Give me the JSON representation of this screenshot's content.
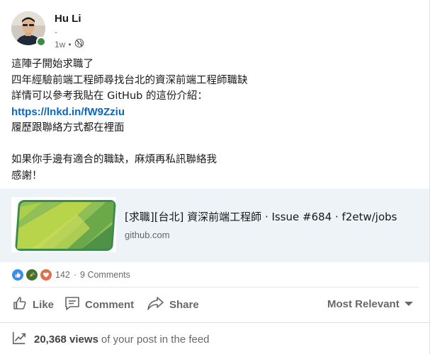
{
  "post": {
    "author": {
      "name": "Hu Li",
      "headline": "-",
      "time": "1w",
      "separator": "•",
      "visibility_icon": "globe-icon",
      "presence": "online"
    },
    "text_lines": [
      "這陣子開始求職了",
      "四年經驗前端工程師尋找台北的資深前端工程師職缺",
      "詳情可以參考我貼在 GitHub 的這份介紹：",
      "https://lnkd.in/fW9Zziu",
      "履歷跟聯絡方式都在裡面",
      "",
      "如果你手邊有適合的職缺，麻煩再私訊聯絡我",
      "感謝！"
    ],
    "link_preview": {
      "title": "[求職][台北] 資深前端工程師 · Issue #684 · f2etw/jobs",
      "domain": "github.com",
      "thumbnail_icon": "github-banner-thumbnail"
    },
    "social_counts": {
      "reactions": "142",
      "separator": "·",
      "comments": "9 Comments",
      "reaction_icons": [
        "like-icon",
        "celebrate-icon",
        "love-icon"
      ]
    },
    "actions": {
      "like": "Like",
      "comment": "Comment",
      "share": "Share",
      "sort": "Most Relevant"
    },
    "analytics": {
      "views": "20,368 views",
      "suffix": "of your post in the feed"
    }
  },
  "colors": {
    "link": "#0a66c2",
    "presence": "#3d8b3f",
    "preview_bg": "#eef3f8",
    "like": "#378fe9",
    "celebrate": "#44712e",
    "love": "#df704d"
  }
}
